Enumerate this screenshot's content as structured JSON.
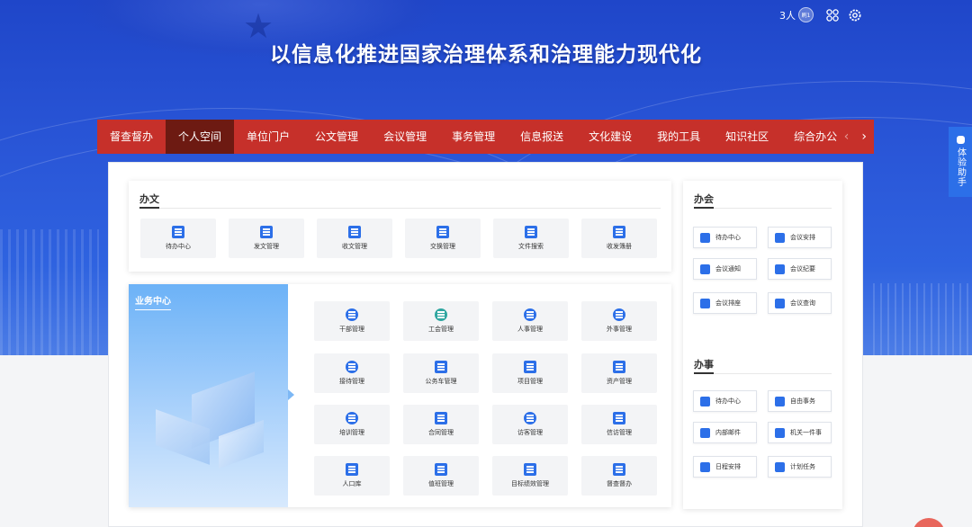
{
  "hero": {
    "title": "以信息化推进国家治理体系和治理能力现代化"
  },
  "topbar": {
    "user_count": "3人",
    "badge": "刷1"
  },
  "nav": {
    "items": [
      "督查督办",
      "个人空间",
      "单位门户",
      "公文管理",
      "会议管理",
      "事务管理",
      "信息报送",
      "文化建设",
      "我的工具",
      "知识社区",
      "综合办公"
    ],
    "active_index": 1,
    "prev_icon": "‹",
    "next_icon": "›"
  },
  "banwen": {
    "title": "办文",
    "tiles": [
      "待办中心",
      "发文管理",
      "收文管理",
      "交换管理",
      "文件搜索",
      "收发簿册"
    ]
  },
  "business": {
    "title": "业务中心",
    "tiles": [
      "干部管理",
      "工会管理",
      "人事管理",
      "外事管理",
      "接待管理",
      "公务车管理",
      "项目管理",
      "资产管理",
      "培训管理",
      "合同管理",
      "访客管理",
      "信访管理",
      "人口库",
      "值班管理",
      "目标绩效管理",
      "督查督办"
    ]
  },
  "banhui": {
    "title": "办会",
    "buttons": [
      "待办中心",
      "会议安排",
      "会议通知",
      "会议纪要",
      "会议排座",
      "会议查询"
    ]
  },
  "banshi": {
    "title": "办事",
    "buttons": [
      "待办中心",
      "自由事务",
      "内部邮件",
      "机关一件事",
      "日程安排",
      "计划任务"
    ]
  },
  "assistant": {
    "label": "体验助手"
  },
  "colors": {
    "nav_bg": "#c6302a",
    "nav_active": "#6d1a12",
    "accent": "#2c6fe8",
    "hero": "#2a57d8"
  }
}
